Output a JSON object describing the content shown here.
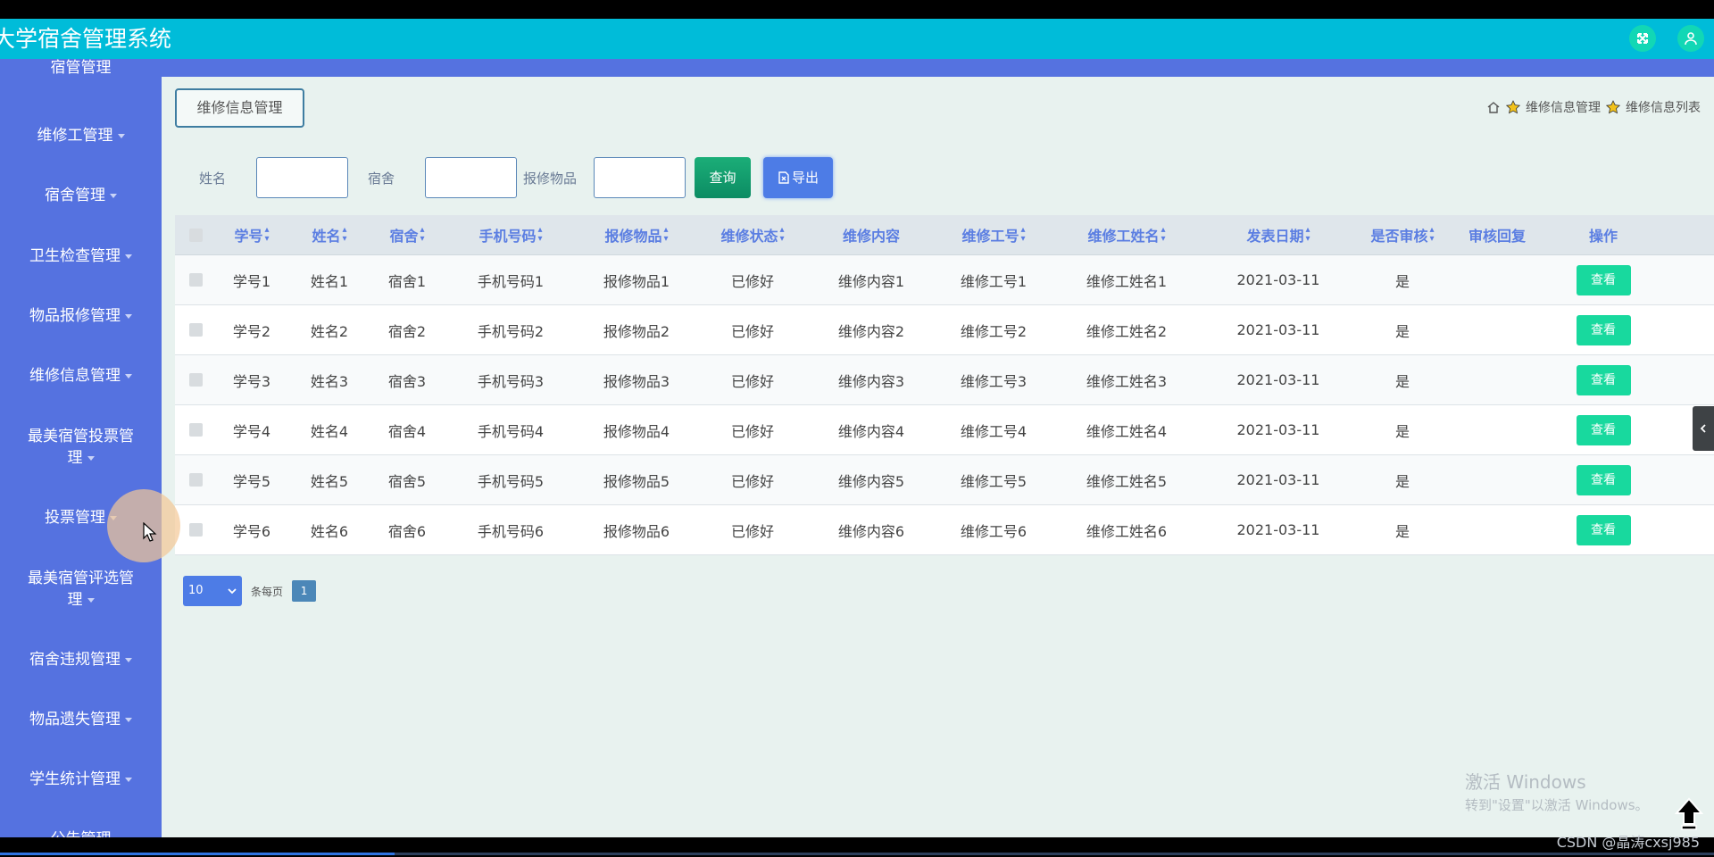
{
  "app": {
    "title": "大学宿舍管理系统"
  },
  "header": {
    "fullscreen_icon": "expand-icon",
    "user_icon": "user-icon"
  },
  "sidebar": {
    "items": [
      {
        "label": "宿管管理"
      },
      {
        "label": "维修工管理"
      },
      {
        "label": "宿舍管理"
      },
      {
        "label": "卫生检查管理"
      },
      {
        "label": "物品报修管理"
      },
      {
        "label": "维修信息管理"
      },
      {
        "label": "最美宿管投票管",
        "label2": "理"
      },
      {
        "label": "投票管理"
      },
      {
        "label": "最美宿管评选管",
        "label2": "理"
      },
      {
        "label": "宿舍违规管理"
      },
      {
        "label": "物品遗失管理"
      },
      {
        "label": "学生统计管理"
      },
      {
        "label": "公告管理"
      }
    ]
  },
  "page": {
    "title": "维修信息管理",
    "breadcrumb": [
      "维修信息管理",
      "维修信息列表"
    ]
  },
  "search": {
    "name_label": "姓名",
    "dorm_label": "宿舍",
    "item_label": "报修物品",
    "name_value": "",
    "dorm_value": "",
    "item_value": "",
    "query_button": "查询",
    "export_button": "导出"
  },
  "table": {
    "headers": [
      "学号",
      "姓名",
      "宿舍",
      "手机号码",
      "报修物品",
      "维修状态",
      "维修内容",
      "维修工号",
      "维修工姓名",
      "发表日期",
      "是否审核",
      "审核回复",
      "操作"
    ],
    "rows": [
      [
        "学号1",
        "姓名1",
        "宿舍1",
        "手机号码1",
        "报修物品1",
        "已修好",
        "维修内容1",
        "维修工号1",
        "维修工姓名1",
        "2021-03-11",
        "是",
        "",
        "查看"
      ],
      [
        "学号2",
        "姓名2",
        "宿舍2",
        "手机号码2",
        "报修物品2",
        "已修好",
        "维修内容2",
        "维修工号2",
        "维修工姓名2",
        "2021-03-11",
        "是",
        "",
        "查看"
      ],
      [
        "学号3",
        "姓名3",
        "宿舍3",
        "手机号码3",
        "报修物品3",
        "已修好",
        "维修内容3",
        "维修工号3",
        "维修工姓名3",
        "2021-03-11",
        "是",
        "",
        "查看"
      ],
      [
        "学号4",
        "姓名4",
        "宿舍4",
        "手机号码4",
        "报修物品4",
        "已修好",
        "维修内容4",
        "维修工号4",
        "维修工姓名4",
        "2021-03-11",
        "是",
        "",
        "查看"
      ],
      [
        "学号5",
        "姓名5",
        "宿舍5",
        "手机号码5",
        "报修物品5",
        "已修好",
        "维修内容5",
        "维修工号5",
        "维修工姓名5",
        "2021-03-11",
        "是",
        "",
        "查看"
      ],
      [
        "学号6",
        "姓名6",
        "宿舍6",
        "手机号码6",
        "报修物品6",
        "已修好",
        "维修内容6",
        "维修工号6",
        "维修工姓名6",
        "2021-03-11",
        "是",
        "",
        "查看"
      ]
    ]
  },
  "pager": {
    "page_size": "10",
    "per_page_label": "条每页",
    "current_page": "1"
  },
  "watermark": {
    "line1": "激活 Windows",
    "line2": "转到\"设置\"以激活 Windows。"
  },
  "footer": {
    "csdn": "CSDN @晶涛cxsj985"
  },
  "video": {
    "progress": 0.23
  },
  "colors": {
    "header": "#00bcd9",
    "sidebar": "#5572e0",
    "view_button": "#18d99e",
    "accent": "#4d7ce6"
  }
}
